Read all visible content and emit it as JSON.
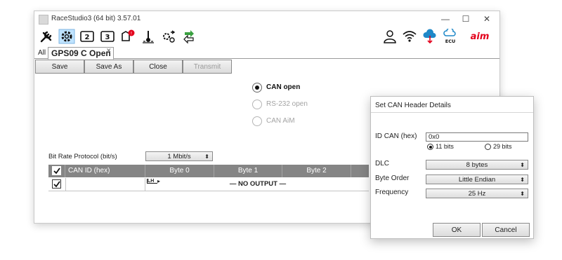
{
  "window": {
    "title": "RaceStudio3 (64 bit) 3.57.01",
    "minimize": "—",
    "maximize": "☐",
    "close": "✕"
  },
  "toolbar": {
    "left_icons": [
      "wrench-icon",
      "gear-icon",
      "device-2-icon",
      "device-3-icon",
      "alert-tool-icon",
      "temperature-icon",
      "settings-sync-icon",
      "transfer-icon"
    ],
    "right_icons": [
      "user-icon",
      "wifi-icon",
      "cloud-download-icon",
      "ecu-cloud-icon",
      "aim-logo"
    ],
    "ecu_label": "ECU",
    "logo_text": "aim"
  },
  "tabs": {
    "all": "All",
    "current": "GPS09 C Open",
    "close": "✕"
  },
  "buttons": {
    "save": "Save",
    "save_as": "Save As",
    "close": "Close",
    "transmit": "Transmit"
  },
  "protocol": {
    "options": [
      {
        "label": "CAN open",
        "selected": true,
        "enabled": true
      },
      {
        "label": "RS-232 open",
        "selected": false,
        "enabled": false
      },
      {
        "label": "CAN AiM",
        "selected": false,
        "enabled": false
      }
    ]
  },
  "bitrate": {
    "label": "Bit Rate Protocol (bit/s)",
    "value": "1 Mbit/s"
  },
  "table": {
    "columns": [
      "CAN ID (hex)",
      "Byte 0",
      "Byte 1",
      "Byte 2"
    ],
    "row": {
      "checked": true,
      "can_id": "",
      "byte0": "LH",
      "content": "— NO OUTPUT —"
    }
  },
  "dialog": {
    "title": "Set CAN Header Details",
    "id_label": "ID CAN (hex)",
    "id_value": "0x0",
    "bits_11": "11 bits",
    "bits_29": "29 bits",
    "dlc_label": "DLC",
    "dlc_value": "8 bytes",
    "byte_order_label": "Byte Order",
    "byte_order_value": "Little Endian",
    "frequency_label": "Frequency",
    "frequency_value": "25 Hz",
    "ok": "OK",
    "cancel": "Cancel"
  },
  "colors": {
    "aim_red": "#e3001b",
    "header_gray": "#858585",
    "cloud_blue": "#1e88c8",
    "arrow_green": "#3aa040"
  }
}
